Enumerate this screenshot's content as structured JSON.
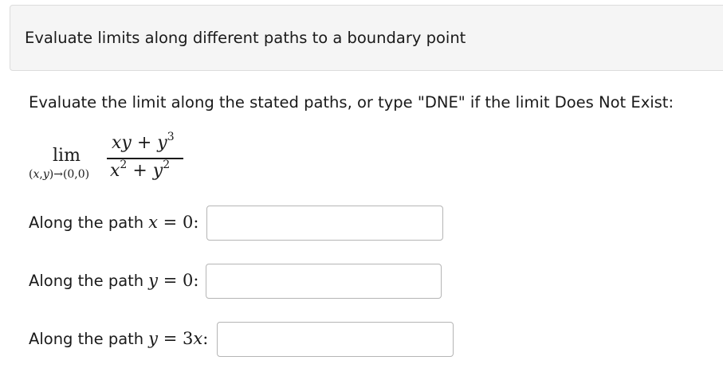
{
  "header": {
    "title": "Evaluate limits along different paths to a boundary point"
  },
  "problem": {
    "instructions": "Evaluate the limit along the stated paths, or type \"DNE\" if the limit Does Not Exist:",
    "limit": {
      "operator": "lim",
      "subscript": "(x,y)→(0,0)",
      "numerator": "xy + y³",
      "denominator": "x² + y²"
    }
  },
  "paths": [
    {
      "label": "Along the path",
      "equation": "x = 0",
      "colon": ":",
      "value": ""
    },
    {
      "label": "Along the path",
      "equation": "y = 0",
      "colon": ":",
      "value": ""
    },
    {
      "label": "Along the path",
      "equation": "y = 3x",
      "colon": ":",
      "value": ""
    }
  ]
}
